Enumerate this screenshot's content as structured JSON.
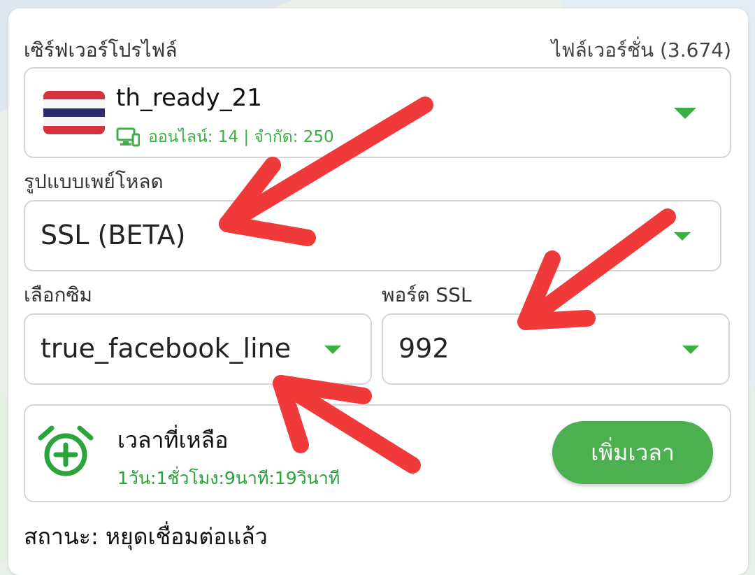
{
  "server_profile": {
    "label": "เซิร์ฟเวอร์โปรไฟล์",
    "file_version": "ไฟล์เวอร์ชั่น (3.674)",
    "selected_name": "th_ready_21",
    "online_info": "ออนไลน์: 14 | จำกัด: 250",
    "flag": "thailand-flag-icon"
  },
  "payload": {
    "label": "รูปแบบเพย์โหลด",
    "value": "SSL (BETA)"
  },
  "sim": {
    "label": "เลือกซิม",
    "value": "true_facebook_line"
  },
  "ssl_port": {
    "label": "พอร์ต SSL",
    "value": "992"
  },
  "time": {
    "title": "เวลาที่เหลือ",
    "remaining": "1วัน:1ชั่วโมง:9นาที:19วินาที",
    "add_button": "เพิ่มเวลา"
  },
  "status": "สถานะ: หยุดเชื่อมต่อแล้ว",
  "colors": {
    "accent": "#4caf50",
    "accent_text": "#27a33a",
    "annotation": "#f03a3a"
  }
}
